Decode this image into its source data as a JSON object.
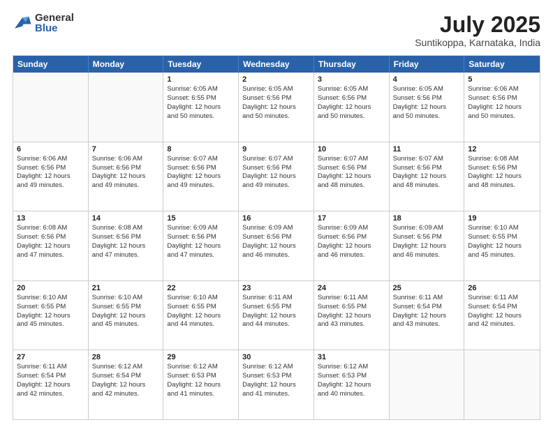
{
  "logo": {
    "general": "General",
    "blue": "Blue"
  },
  "title": {
    "month_year": "July 2025",
    "location": "Suntikoppa, Karnataka, India"
  },
  "header_days": [
    "Sunday",
    "Monday",
    "Tuesday",
    "Wednesday",
    "Thursday",
    "Friday",
    "Saturday"
  ],
  "weeks": [
    [
      {
        "day": "",
        "info": ""
      },
      {
        "day": "",
        "info": ""
      },
      {
        "day": "1",
        "info": "Sunrise: 6:05 AM\nSunset: 6:55 PM\nDaylight: 12 hours\nand 50 minutes."
      },
      {
        "day": "2",
        "info": "Sunrise: 6:05 AM\nSunset: 6:56 PM\nDaylight: 12 hours\nand 50 minutes."
      },
      {
        "day": "3",
        "info": "Sunrise: 6:05 AM\nSunset: 6:56 PM\nDaylight: 12 hours\nand 50 minutes."
      },
      {
        "day": "4",
        "info": "Sunrise: 6:05 AM\nSunset: 6:56 PM\nDaylight: 12 hours\nand 50 minutes."
      },
      {
        "day": "5",
        "info": "Sunrise: 6:06 AM\nSunset: 6:56 PM\nDaylight: 12 hours\nand 50 minutes."
      }
    ],
    [
      {
        "day": "6",
        "info": "Sunrise: 6:06 AM\nSunset: 6:56 PM\nDaylight: 12 hours\nand 49 minutes."
      },
      {
        "day": "7",
        "info": "Sunrise: 6:06 AM\nSunset: 6:56 PM\nDaylight: 12 hours\nand 49 minutes."
      },
      {
        "day": "8",
        "info": "Sunrise: 6:07 AM\nSunset: 6:56 PM\nDaylight: 12 hours\nand 49 minutes."
      },
      {
        "day": "9",
        "info": "Sunrise: 6:07 AM\nSunset: 6:56 PM\nDaylight: 12 hours\nand 49 minutes."
      },
      {
        "day": "10",
        "info": "Sunrise: 6:07 AM\nSunset: 6:56 PM\nDaylight: 12 hours\nand 48 minutes."
      },
      {
        "day": "11",
        "info": "Sunrise: 6:07 AM\nSunset: 6:56 PM\nDaylight: 12 hours\nand 48 minutes."
      },
      {
        "day": "12",
        "info": "Sunrise: 6:08 AM\nSunset: 6:56 PM\nDaylight: 12 hours\nand 48 minutes."
      }
    ],
    [
      {
        "day": "13",
        "info": "Sunrise: 6:08 AM\nSunset: 6:56 PM\nDaylight: 12 hours\nand 47 minutes."
      },
      {
        "day": "14",
        "info": "Sunrise: 6:08 AM\nSunset: 6:56 PM\nDaylight: 12 hours\nand 47 minutes."
      },
      {
        "day": "15",
        "info": "Sunrise: 6:09 AM\nSunset: 6:56 PM\nDaylight: 12 hours\nand 47 minutes."
      },
      {
        "day": "16",
        "info": "Sunrise: 6:09 AM\nSunset: 6:56 PM\nDaylight: 12 hours\nand 46 minutes."
      },
      {
        "day": "17",
        "info": "Sunrise: 6:09 AM\nSunset: 6:56 PM\nDaylight: 12 hours\nand 46 minutes."
      },
      {
        "day": "18",
        "info": "Sunrise: 6:09 AM\nSunset: 6:56 PM\nDaylight: 12 hours\nand 46 minutes."
      },
      {
        "day": "19",
        "info": "Sunrise: 6:10 AM\nSunset: 6:55 PM\nDaylight: 12 hours\nand 45 minutes."
      }
    ],
    [
      {
        "day": "20",
        "info": "Sunrise: 6:10 AM\nSunset: 6:55 PM\nDaylight: 12 hours\nand 45 minutes."
      },
      {
        "day": "21",
        "info": "Sunrise: 6:10 AM\nSunset: 6:55 PM\nDaylight: 12 hours\nand 45 minutes."
      },
      {
        "day": "22",
        "info": "Sunrise: 6:10 AM\nSunset: 6:55 PM\nDaylight: 12 hours\nand 44 minutes."
      },
      {
        "day": "23",
        "info": "Sunrise: 6:11 AM\nSunset: 6:55 PM\nDaylight: 12 hours\nand 44 minutes."
      },
      {
        "day": "24",
        "info": "Sunrise: 6:11 AM\nSunset: 6:55 PM\nDaylight: 12 hours\nand 43 minutes."
      },
      {
        "day": "25",
        "info": "Sunrise: 6:11 AM\nSunset: 6:54 PM\nDaylight: 12 hours\nand 43 minutes."
      },
      {
        "day": "26",
        "info": "Sunrise: 6:11 AM\nSunset: 6:54 PM\nDaylight: 12 hours\nand 42 minutes."
      }
    ],
    [
      {
        "day": "27",
        "info": "Sunrise: 6:11 AM\nSunset: 6:54 PM\nDaylight: 12 hours\nand 42 minutes."
      },
      {
        "day": "28",
        "info": "Sunrise: 6:12 AM\nSunset: 6:54 PM\nDaylight: 12 hours\nand 42 minutes."
      },
      {
        "day": "29",
        "info": "Sunrise: 6:12 AM\nSunset: 6:53 PM\nDaylight: 12 hours\nand 41 minutes."
      },
      {
        "day": "30",
        "info": "Sunrise: 6:12 AM\nSunset: 6:53 PM\nDaylight: 12 hours\nand 41 minutes."
      },
      {
        "day": "31",
        "info": "Sunrise: 6:12 AM\nSunset: 6:53 PM\nDaylight: 12 hours\nand 40 minutes."
      },
      {
        "day": "",
        "info": ""
      },
      {
        "day": "",
        "info": ""
      }
    ]
  ]
}
